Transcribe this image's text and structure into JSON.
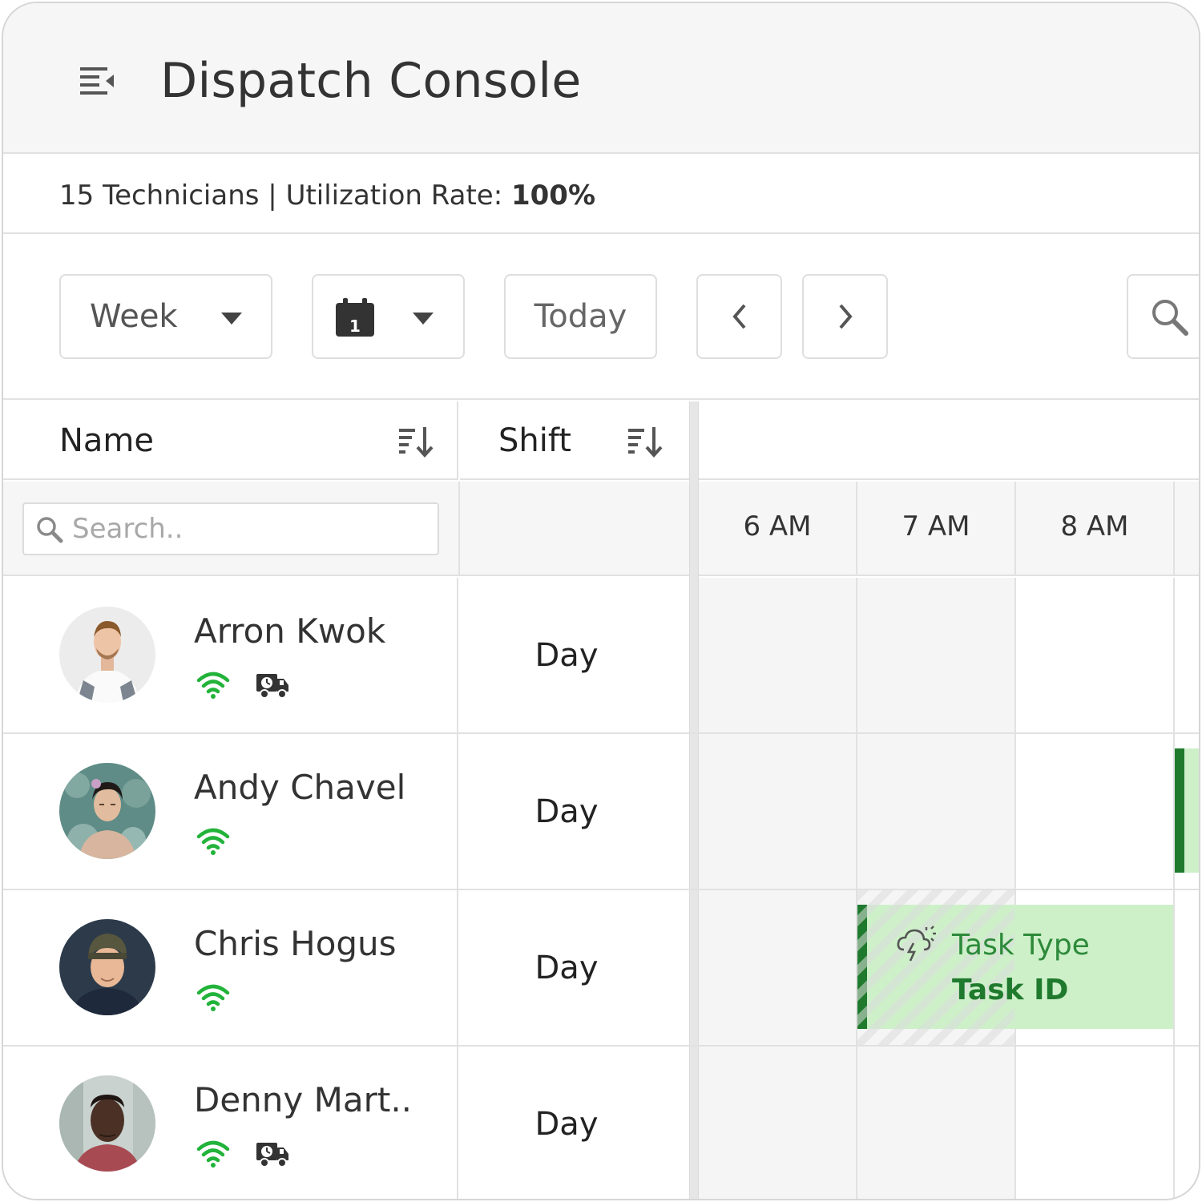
{
  "header": {
    "title": "Dispatch Console",
    "menu_icon": "menu-collapse-icon"
  },
  "stats": {
    "technicians": "15 Technicians",
    "separator": "|",
    "utilization_label": "Utilization Rate:",
    "utilization_value": "100%"
  },
  "toolbar": {
    "view_select": "Week",
    "calendar_icon": "calendar-icon",
    "calendar_day": "1",
    "today_label": "Today",
    "prev_icon": "chevron-left-icon",
    "next_icon": "chevron-right-icon",
    "search_icon": "search-icon"
  },
  "columns": {
    "name": "Name",
    "shift": "Shift"
  },
  "filter": {
    "search_placeholder": "Search.."
  },
  "timeline": {
    "hours": [
      "6 AM",
      "7 AM",
      "8 AM"
    ]
  },
  "technicians": [
    {
      "name": "Arron Kwok",
      "shift": "Day",
      "online": true,
      "on_route": true
    },
    {
      "name": "Andy Chavel",
      "shift": "Day",
      "online": true,
      "on_route": false
    },
    {
      "name": "Chris Hogus",
      "shift": "Day",
      "online": true,
      "on_route": false
    },
    {
      "name": "Denny Mart..",
      "shift": "Day",
      "online": true,
      "on_route": true
    }
  ],
  "task": {
    "type": "Task Type",
    "id": "Task ID",
    "icon": "weather-storm-icon"
  },
  "colors": {
    "accent_green": "#1f7a2d",
    "task_fill": "#cdf0c9",
    "online_green": "#22b33a"
  }
}
